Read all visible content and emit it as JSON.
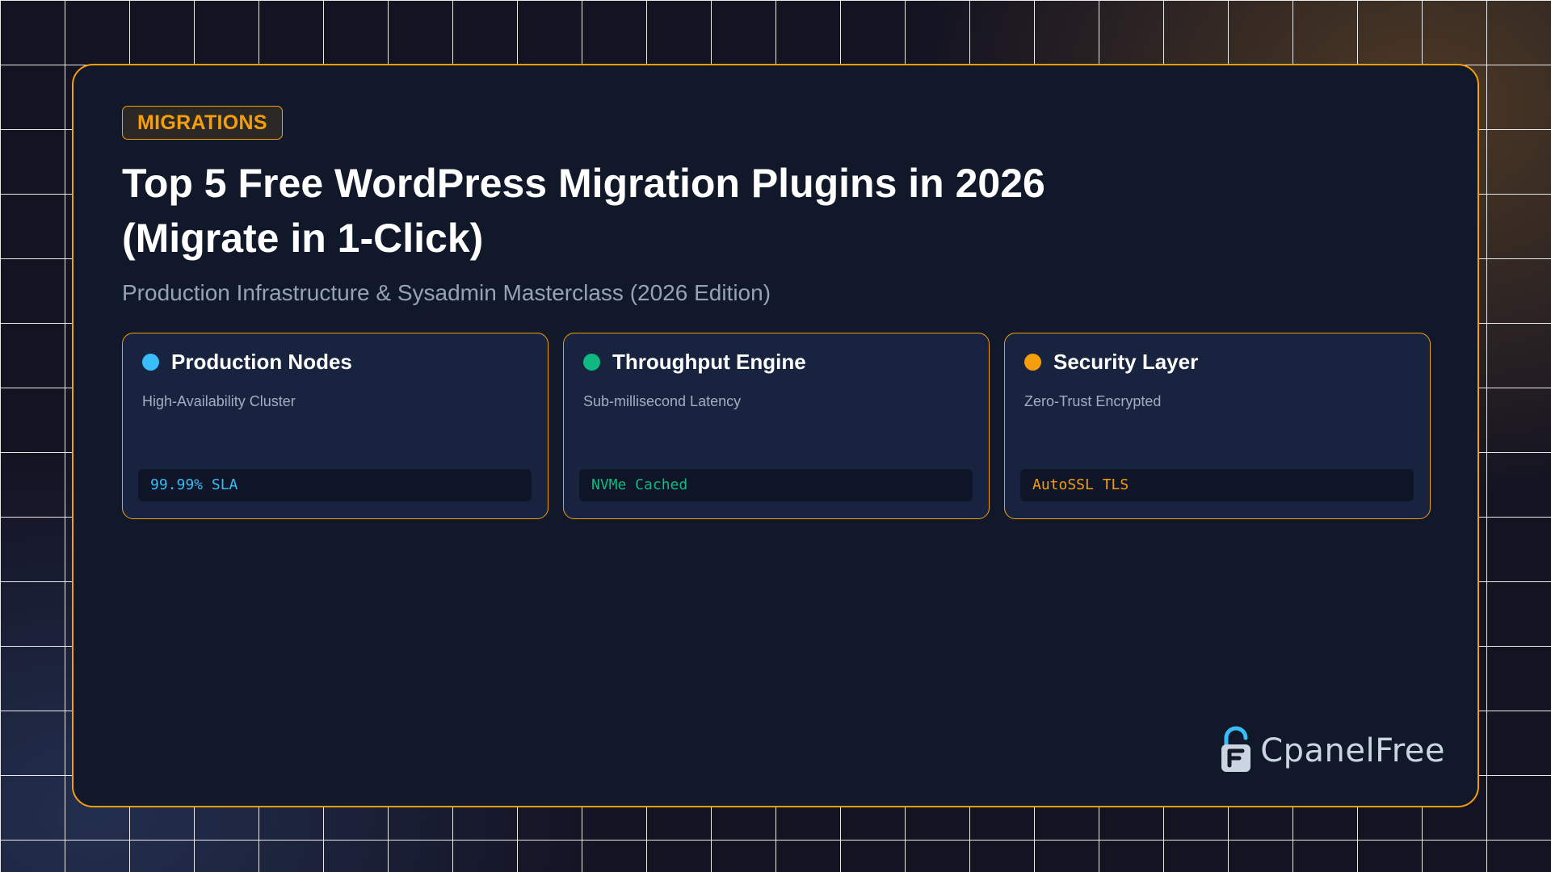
{
  "hero": {
    "badge": "MIGRATIONS",
    "title": "Top 5 Free WordPress Migration Plugins in 2026 (Migrate in 1-Click)",
    "subtitle": "Production Infrastructure & Sysadmin Masterclass (2026 Edition)"
  },
  "features": [
    {
      "title": "Production Nodes",
      "description": "High-Availability Cluster",
      "code": "99.99% SLA",
      "accent_color": "#38bdf8"
    },
    {
      "title": "Throughput Engine",
      "description": "Sub-millisecond Latency",
      "code": "NVMe Cached",
      "accent_color": "#10b981"
    },
    {
      "title": "Security Layer",
      "description": "Zero-Trust Encrypted",
      "code": "AutoSSL TLS",
      "accent_color": "#f59e0b"
    }
  ],
  "brand": {
    "name": "CpanelFree",
    "icon": "padlock-logo-icon",
    "icon_color": "#38bdf8"
  },
  "colors": {
    "accent": "#f59e0b",
    "card_background": "#101829"
  }
}
